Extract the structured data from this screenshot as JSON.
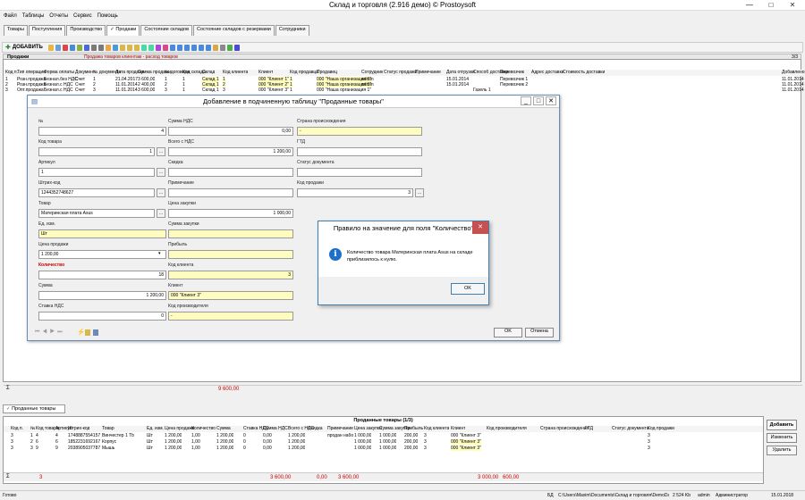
{
  "window": {
    "title": "Склад и торговля (2.916 демо) © Prostoysoft",
    "min": "—",
    "max": "□",
    "close": "✕"
  },
  "menu": [
    "Файл",
    "Таблицы",
    "Отчеты",
    "Сервис",
    "Помощь"
  ],
  "tabs": [
    "Товары",
    "Поступления",
    "Производство",
    "✓ Продажи",
    "Состояние складов",
    "Состояние складов с резервами",
    "Сотрудники"
  ],
  "toolbar": {
    "add_label": "ДОБАВИТЬ"
  },
  "section": {
    "title": "Продажи",
    "subtitle": "Продажа товаров клиентам - расход товаров",
    "counter": "3/3"
  },
  "top_grid": {
    "headers": [
      "Код п.",
      "Тип операции",
      "Форма оплаты",
      "Документ",
      "№ документа",
      "Дата продажи",
      "Сумма продажи",
      "№ договора",
      "Код склада",
      "Склад",
      "Код клиента",
      "Клиент",
      "Код продавца",
      "Продавец",
      "Сотрудник",
      "Статус продажи",
      "Примечание",
      "Дата отгрузки",
      "Способ доставки",
      "Перевозчик",
      "Адрес доставки",
      "Стоимость доставки",
      "Добавлено"
    ],
    "rows": [
      [
        "1",
        "Розн.продажа",
        "Безнал.без НДС",
        "Счет",
        "1",
        "21.04.2017",
        "3 600,00",
        "1",
        "1",
        "Склад 1",
        "1",
        "000 \"Клиент 1\"",
        "1",
        "000 \"Наша организация 1\"",
        "admin",
        "",
        "",
        "15.01.2014",
        "",
        "Перевозчик 1",
        "",
        "",
        "11.01.2014 12:01"
      ],
      [
        "2",
        "Розн.продажа",
        "Безнал.с НДС",
        "Счет",
        "2",
        "11.01.2014",
        "2 400,00",
        "2",
        "1",
        "Склад 1",
        "2",
        "000 \"Клиент 2\"",
        "1",
        "000 \"Наша организация 1\"",
        "admin",
        "",
        "",
        "15.01.2014",
        "",
        "Перевозчик 2",
        "",
        "",
        "11.01.2014 12:02"
      ],
      [
        "3",
        "Опт.продажа",
        "Безнал.с НДС",
        "Счет",
        "3",
        "11.01.2014",
        "3 600,00",
        "3",
        "1",
        "Склад 1",
        "3",
        "000 \"Клиент 3\"",
        "1",
        "000 \"Наша организация 1\"",
        "",
        "",
        "",
        "",
        "Газель 1",
        "",
        "",
        "",
        "11.01.2014 12:01"
      ]
    ],
    "total": "9 600,00",
    "sigma": "Σ"
  },
  "dialog": {
    "title": "Добавление в подчиненную таблицу \"Проданные товары\"",
    "fields": {
      "num": {
        "label": "№",
        "value": "4"
      },
      "code": {
        "label": "Код товара",
        "value": "1"
      },
      "article": {
        "label": "Артикул",
        "value": "1"
      },
      "barcode": {
        "label": "Штрих-код",
        "value": "1244352748627"
      },
      "product": {
        "label": "Товар",
        "value": "Материнская плата Asus"
      },
      "unit": {
        "label": "Ед. изм.",
        "value": "Шт"
      },
      "price": {
        "label": "Цена продажи",
        "value": "1 200,00"
      },
      "qty": {
        "label": "Количество",
        "value": "18"
      },
      "sum": {
        "label": "Сумма",
        "value": "1 200,00"
      },
      "vat_rate": {
        "label": "Ставка НДС",
        "value": "0"
      },
      "vat_sum": {
        "label": "Сумма НДС",
        "value": "0,00"
      },
      "total_vat": {
        "label": "Всего с НДС",
        "value": "1 200,00"
      },
      "discount": {
        "label": "Скидка",
        "value": ""
      },
      "note": {
        "label": "Примечание",
        "value": ""
      },
      "purchase_price": {
        "label": "Цена закупки",
        "value": "1 000,00"
      },
      "purchase_sum": {
        "label": "Сумма закупки",
        "value": ""
      },
      "profit": {
        "label": "Прибыль",
        "value": ""
      },
      "client_code": {
        "label": "Код клиента",
        "value": "3"
      },
      "client": {
        "label": "Клиент",
        "value": "000 \"Клиент 3\""
      },
      "producer_code": {
        "label": "Код производителя",
        "value": "-"
      },
      "country": {
        "label": "Страна происхождения",
        "value": "-"
      },
      "gtd": {
        "label": "ГТД",
        "value": ""
      },
      "doc_status": {
        "label": "Статус документа",
        "value": ""
      },
      "sale_code": {
        "label": "Код продажи",
        "value": "3"
      }
    },
    "ok": "OK",
    "cancel": "Отмена"
  },
  "msgbox": {
    "title": "Правило на значение для поля \"Количество\"",
    "text1": "Количество товара Материнская плата Asus на складе",
    "text2": "приблизилось к нулю.",
    "ok": "OK"
  },
  "bottom": {
    "tab": "Проданные товары",
    "title": "Проданные товары (1/3)",
    "headers": [
      "Код п.",
      "№",
      "Код товара",
      "Артикул",
      "Штрих-код",
      "Товар",
      "Ед. изм.",
      "Цена продажи",
      "Количество",
      "Сумма",
      "Ставка НДС",
      "Сумма НДС",
      "Всего с НДС",
      "Скидка",
      "Примечание",
      "Цена закупки",
      "Сумма закупки",
      "Прибыль",
      "Код клиента",
      "Клиент",
      "Код производителя",
      "Страна происхождения",
      "ГТД",
      "Статус документа",
      "Код продажи"
    ],
    "rows": [
      [
        "3",
        "1",
        "4",
        "4",
        "1748887554157",
        "Винчестер 1 Tb",
        "Шт",
        "1 200,00",
        "1,00",
        "1 200,00",
        "0",
        "0,00",
        "1 200,00",
        "",
        "продан набо",
        "1 000,00",
        "1 000,00",
        "200,00",
        "3",
        "000 \"Клиент 3\"",
        "",
        "",
        "",
        "",
        "3"
      ],
      [
        "3",
        "2",
        "6",
        "6",
        "1852231692167",
        "Корпус",
        "Шт",
        "1 200,00",
        "1,00",
        "1 200,00",
        "0",
        "0,00",
        "1 200,00",
        "",
        "",
        "1 000,00",
        "1 000,00",
        "200,00",
        "3",
        "000 \"Клиент 3\"",
        "",
        "",
        "",
        "",
        "3"
      ],
      [
        "3",
        "3",
        "9",
        "9",
        "2038905037787",
        "Мышь",
        "Шт",
        "1 200,00",
        "1,00",
        "1 200,00",
        "0",
        "0,00",
        "1 200,00",
        "",
        "",
        "1 000,00",
        "1 000,00",
        "200,00",
        "3",
        "000 \"Клиент 3\"",
        "",
        "",
        "",
        "",
        "3"
      ]
    ],
    "totals": {
      "count": "3",
      "sum": "3 600,00",
      "vat": "0,00",
      "total": "3 600,00",
      "purchase": "3 000,00",
      "profit": "600,00"
    },
    "buttons": {
      "add": "Добавить",
      "edit": "Изменить",
      "delete": "Удалить"
    }
  },
  "status": {
    "left": "Готово",
    "db": "БД",
    "path": "C:\\Users\\Maxim\\Documents\\Склад и торговля\\DemoDatabase.mdb",
    "size": "2 524 Kb",
    "user": "admin",
    "role": "Администратор",
    "date": "15.01.2018"
  }
}
